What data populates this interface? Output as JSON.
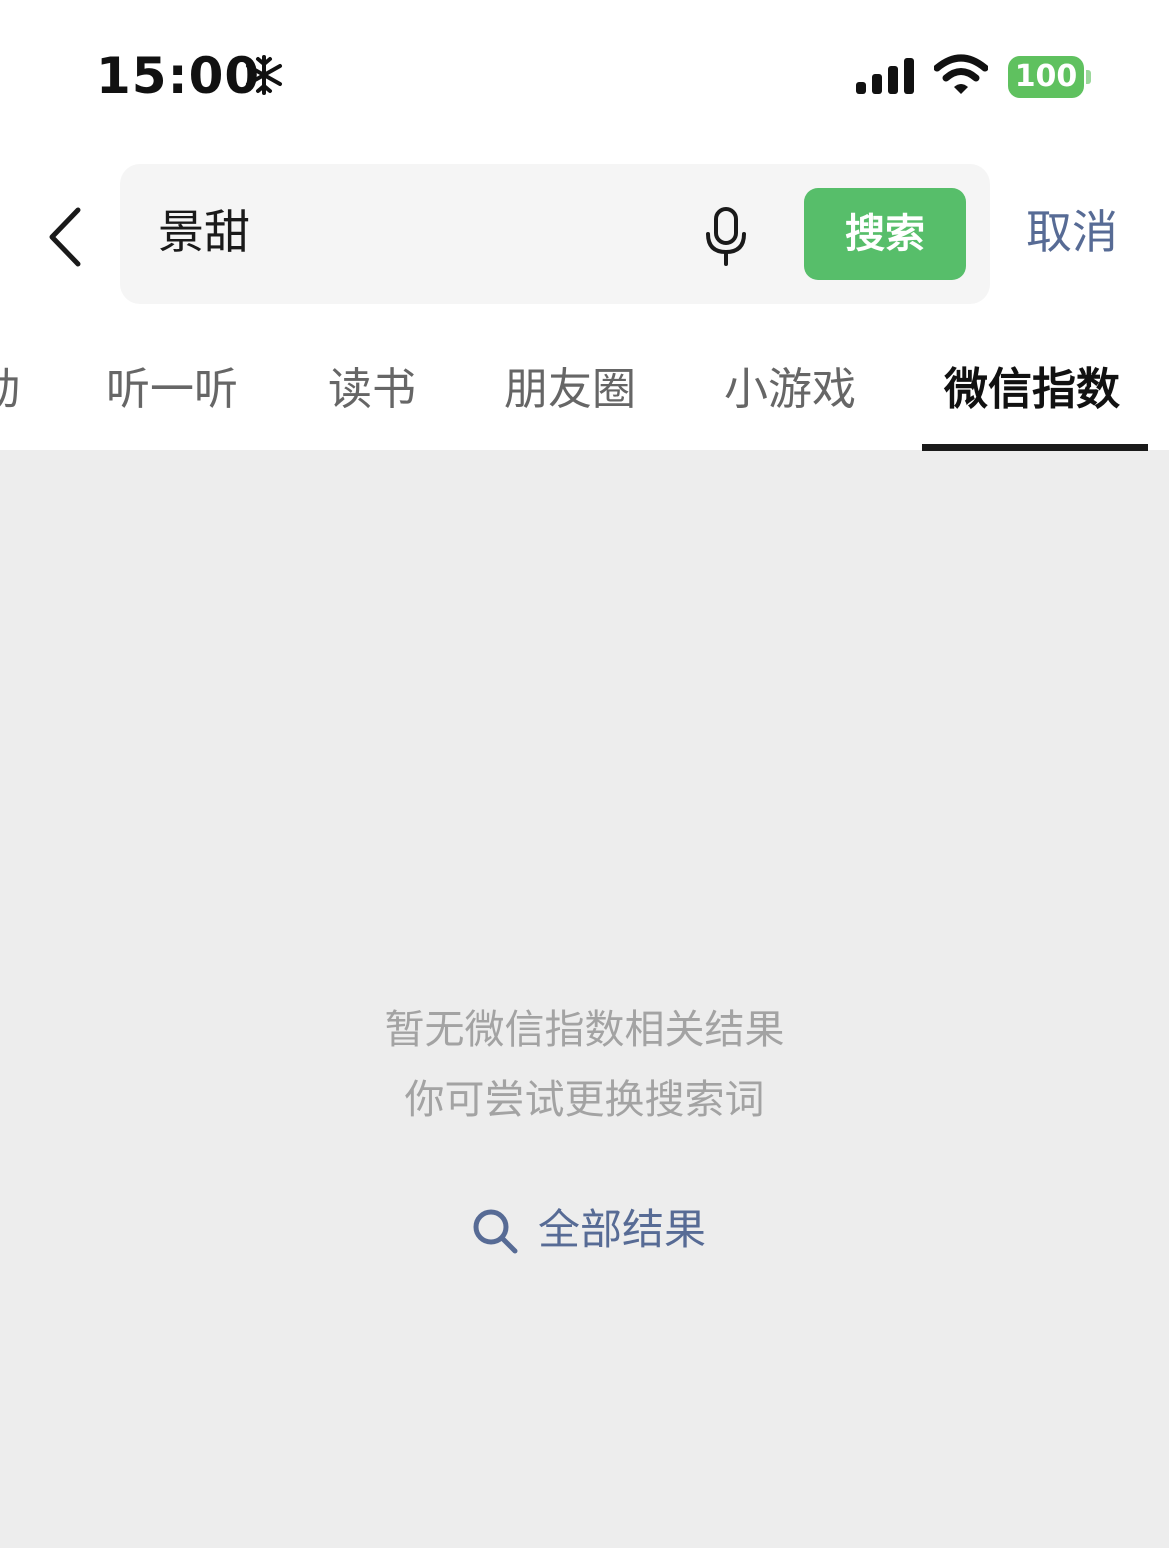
{
  "status_bar": {
    "time": "15:00",
    "battery_level": "100"
  },
  "search": {
    "query": "景甜",
    "button_label": "搜索",
    "cancel_label": "取消"
  },
  "tabs": [
    {
      "label": "动"
    },
    {
      "label": "听一听"
    },
    {
      "label": "读书"
    },
    {
      "label": "朋友圈"
    },
    {
      "label": "小游戏"
    },
    {
      "label": "微信指数",
      "active": true
    }
  ],
  "empty_state": {
    "line1": "暂无微信指数相关结果",
    "line2": "你可尝试更换搜索词",
    "all_results_label": "全部结果"
  },
  "colors": {
    "accent_green": "#57be6a",
    "link_blue": "#576b95",
    "battery_green": "#5fc15f"
  }
}
